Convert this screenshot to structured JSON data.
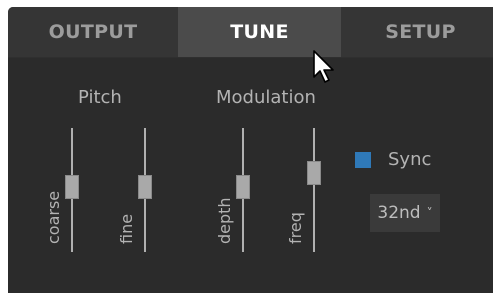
{
  "tabs": {
    "output": "OUTPUT",
    "tune": "TUNE",
    "setup": "SETUP"
  },
  "active_tab": "TUNE",
  "pitch": {
    "title": "Pitch",
    "coarse_label": "coarse",
    "fine_label": "fine"
  },
  "modulation": {
    "title": "Modulation",
    "depth_label": "depth",
    "freq_label": "freq"
  },
  "sync": {
    "label": "Sync",
    "checked": true
  },
  "rate_select": {
    "value": "32nd",
    "chevron": "˅"
  },
  "colors": {
    "panel_bg": "#2b2b2b",
    "active_tab_bg": "#4b4b4b",
    "checkbox_blue": "#2f79b8"
  },
  "icons": [
    "chevron-down-icon",
    "mouse-pointer-icon"
  ]
}
